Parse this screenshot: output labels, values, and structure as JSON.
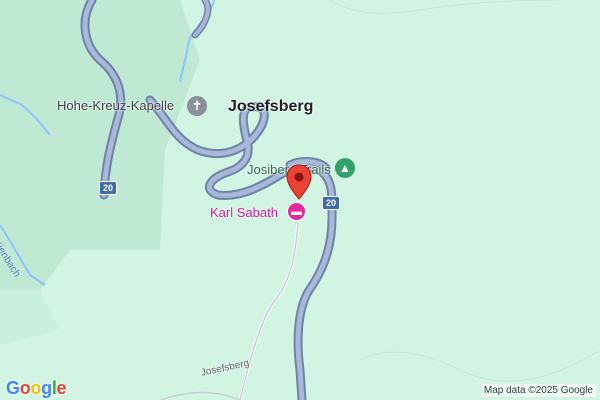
{
  "map": {
    "places": {
      "town": "Josefsberg",
      "chapel": "Hohe-Kreuz-Kapelle",
      "trails": "Josiberg Trails",
      "hotel": "Karl Sabath"
    },
    "roads": {
      "route_number": "20",
      "street_name": "Josefsberg"
    },
    "water": {
      "stream_name": "Kienbach"
    },
    "icons": {
      "chapel": "church-cross-icon",
      "trails": "pine-tree-icon",
      "hotel": "bed-icon",
      "marker": "red-location-pin"
    },
    "colors": {
      "land": "#d2f5e3",
      "forest": "#bfe9d2",
      "road_fill": "#a7b8d8",
      "road_casing": "#6f83a8",
      "water": "#8fc3ff",
      "pin": "#ea4335",
      "hotel": "#d81b9e"
    }
  },
  "branding": {
    "logo_letters": [
      "G",
      "o",
      "o",
      "g",
      "l",
      "e"
    ],
    "logo_colors": [
      "#4285f4",
      "#ea4335",
      "#fbbc05",
      "#4285f4",
      "#34a853",
      "#ea4335"
    ],
    "attribution": "Map data ©2025 Google"
  }
}
